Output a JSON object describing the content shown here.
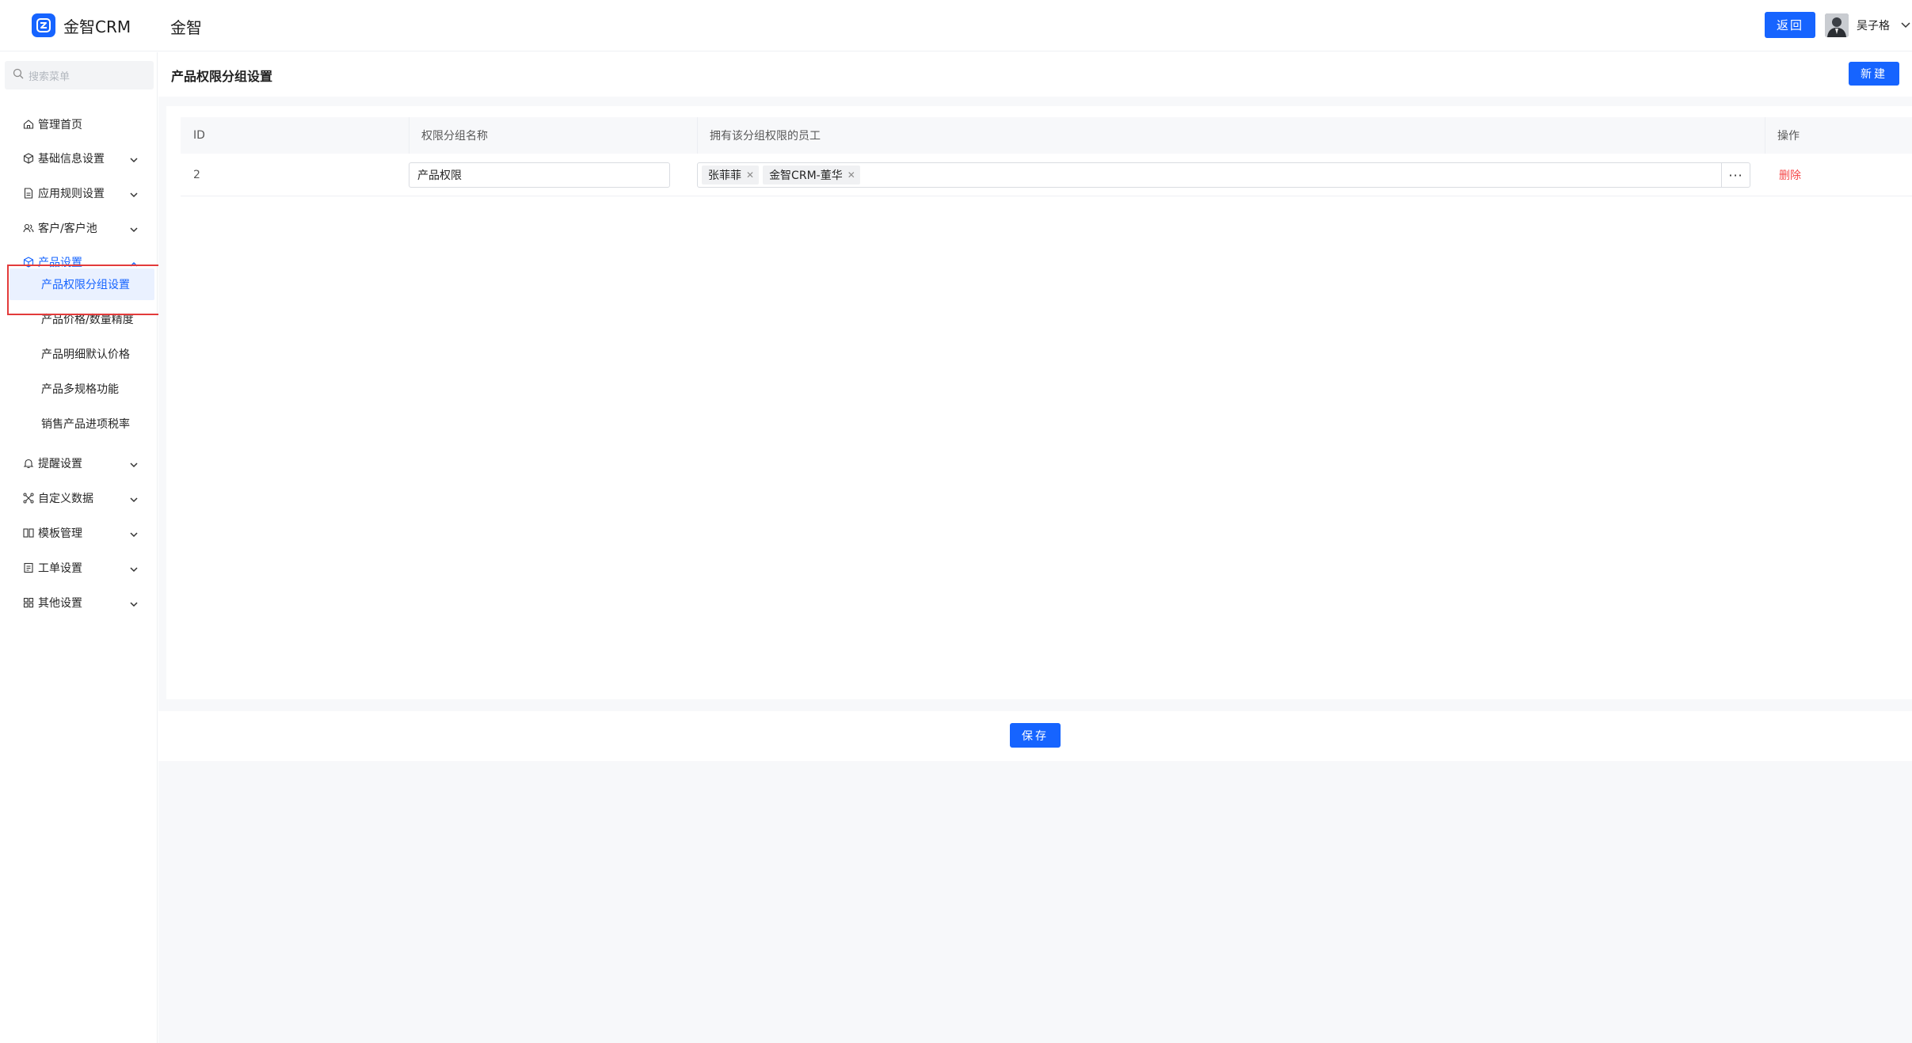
{
  "header": {
    "logo_text": "金智CRM",
    "org_name": "金智",
    "back_label": "返回",
    "user_name": "吴子格"
  },
  "sidebar": {
    "search_placeholder": "搜索菜单",
    "items": [
      {
        "label": "管理首页",
        "icon": "home-icon",
        "caret": "none"
      },
      {
        "label": "基础信息设置",
        "icon": "cube-icon",
        "caret": "down"
      },
      {
        "label": "应用规则设置",
        "icon": "document-icon",
        "caret": "down"
      },
      {
        "label": "客户/客户池",
        "icon": "customers-icon",
        "caret": "down"
      },
      {
        "label": "产品设置",
        "icon": "product-icon",
        "caret": "up"
      },
      {
        "label": "提醒设置",
        "icon": "bell-icon",
        "caret": "down"
      },
      {
        "label": "自定义数据",
        "icon": "custom-data-icon",
        "caret": "down"
      },
      {
        "label": "模板管理",
        "icon": "template-icon",
        "caret": "down"
      },
      {
        "label": "工单设置",
        "icon": "ticket-icon",
        "caret": "down"
      },
      {
        "label": "其他设置",
        "icon": "grid-icon",
        "caret": "down"
      }
    ],
    "product_sub_items": [
      "产品权限分组设置",
      "产品价格/数量精度",
      "产品明细默认价格",
      "产品多规格功能",
      "销售产品进项税率"
    ],
    "active_sub_item": "产品权限分组设置"
  },
  "main": {
    "page_title": "产品权限分组设置",
    "new_label": "新建",
    "save_label": "保存",
    "table": {
      "columns": [
        "ID",
        "权限分组名称",
        "拥有该分组权限的员工",
        "操作"
      ],
      "rows": [
        {
          "id": "2",
          "name": "产品权限",
          "employees": [
            "张菲菲",
            "金智CRM-董华"
          ],
          "more": "···",
          "action": "删除"
        }
      ]
    }
  },
  "colors": {
    "primary": "#1664ff",
    "danger": "#f5484a",
    "highlight_box": "#e33b3b"
  }
}
